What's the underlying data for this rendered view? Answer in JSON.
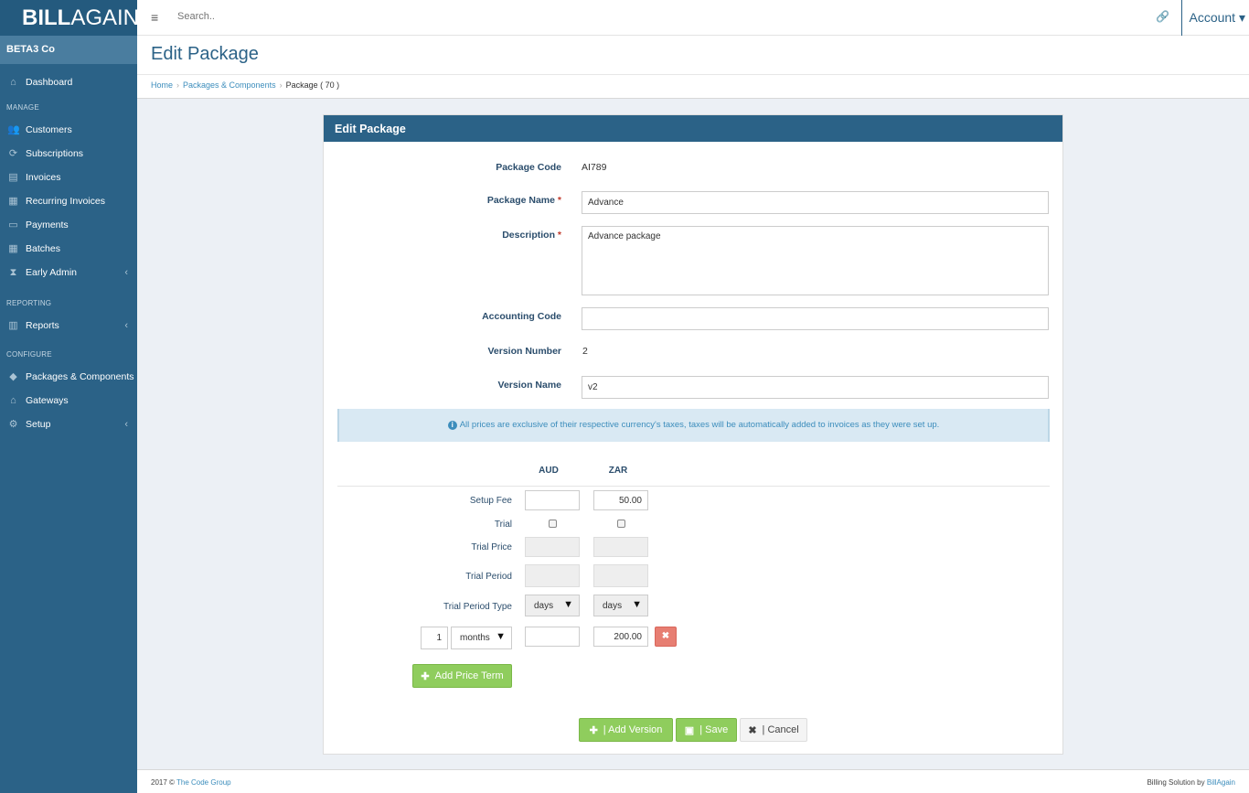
{
  "brand": {
    "bold": "BILL",
    "rest": "AGAIN"
  },
  "company": "BETA3 Co",
  "sidebar": {
    "dashboard": "Dashboard",
    "manage_section": "MANAGE",
    "manage_items": [
      {
        "label": "Customers",
        "icon": "users-icon"
      },
      {
        "label": "Subscriptions",
        "icon": "refresh-icon"
      },
      {
        "label": "Invoices",
        "icon": "file-icon"
      },
      {
        "label": "Recurring Invoices",
        "icon": "calendar-icon"
      },
      {
        "label": "Payments",
        "icon": "money-icon"
      },
      {
        "label": "Batches",
        "icon": "table-icon"
      },
      {
        "label": "Early Admin",
        "icon": "hourglass-icon"
      }
    ],
    "reporting_section": "REPORTING",
    "reports": "Reports",
    "configure_section": "CONFIGURE",
    "configure_items": [
      {
        "label": "Packages & Components",
        "icon": "tags-icon"
      },
      {
        "label": "Gateways",
        "icon": "bank-icon"
      },
      {
        "label": "Setup",
        "icon": "gear-icon"
      }
    ]
  },
  "topbar": {
    "search_placeholder": "Search..",
    "account": "Account ▾"
  },
  "page": {
    "title": "Edit Package"
  },
  "breadcrumb": {
    "home": "Home",
    "packages": "Packages & Components",
    "current": "Package ( 70 )"
  },
  "panel": {
    "heading": "Edit Package",
    "package_code_label": "Package Code",
    "package_code": "AI789",
    "package_name_label": "Package Name",
    "package_name": "Advance",
    "description_label": "Description",
    "description": "Advance package",
    "accounting_code_label": "Accounting Code",
    "accounting_code": "",
    "version_number_label": "Version Number",
    "version_number": "2",
    "version_name_label": "Version Name",
    "version_name": "v2",
    "info": "All prices are exclusive of their respective currency's taxes, taxes will be automatically added to invoices as they were set up."
  },
  "pricing": {
    "currencies": [
      "AUD",
      "ZAR"
    ],
    "setup_fee_label": "Setup Fee",
    "setup_fee": [
      "",
      "50.00"
    ],
    "trial_label": "Trial",
    "trial_price_label": "Trial Price",
    "trial_period_label": "Trial Period",
    "trial_period_type_label": "Trial Period Type",
    "trial_period_type": [
      "days",
      "days"
    ],
    "term_qty": "1",
    "term_unit": "months",
    "term_prices": [
      "",
      "200.00"
    ],
    "add_price_term": "Add Price Term"
  },
  "buttons": {
    "add_version": "| Add Version",
    "save": "| Save",
    "cancel": "| Cancel"
  },
  "footer": {
    "left_prefix": "2017 ©",
    "left_link": "The Code Group",
    "right_prefix": "Billing Solution by",
    "right_link": "BillAgain"
  }
}
